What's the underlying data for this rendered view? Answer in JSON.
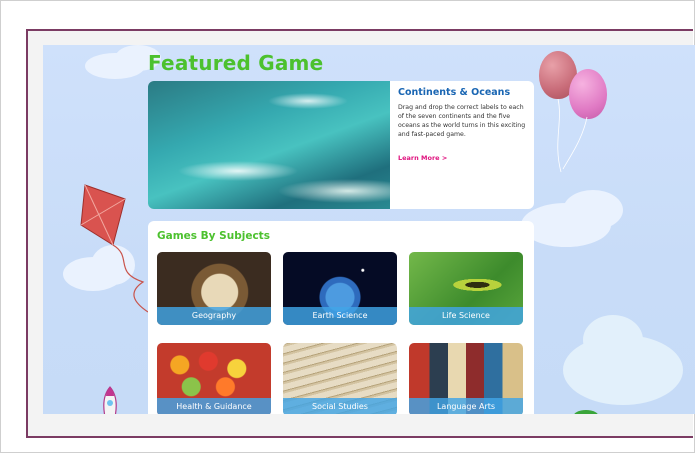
{
  "featured": {
    "heading": "Featured Game",
    "game_title": "Continents & Oceans",
    "description": "Drag and drop the correct labels to each of the seven continents and the five oceans as the world turns in this exciting and fast-paced game.",
    "link_label": "Learn More >"
  },
  "subjects": {
    "heading": "Games By Subjects",
    "tiles": [
      {
        "label": "Geography"
      },
      {
        "label": "Earth Science"
      },
      {
        "label": "Life Science"
      },
      {
        "label": "Health & Guidance"
      },
      {
        "label": "Social Studies"
      },
      {
        "label": "Language Arts"
      }
    ]
  },
  "colors": {
    "heading_green": "#4cc12e",
    "title_blue": "#1a66b3",
    "link_pink": "#e0137f",
    "label_bar_blue": "#41a5e6",
    "frame_border": "#7b3b63",
    "sky": "#cfe1fb"
  }
}
